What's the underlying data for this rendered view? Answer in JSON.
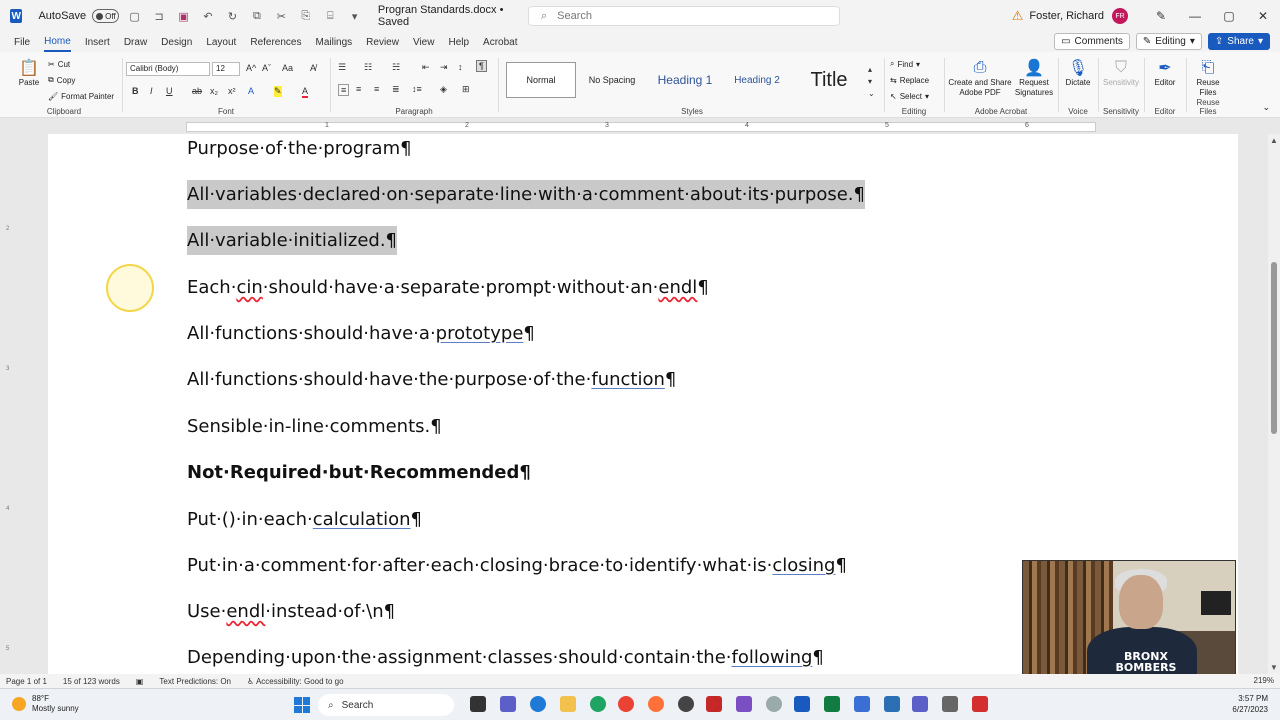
{
  "window": {
    "app_logo": "W",
    "autosave_label": "AutoSave",
    "autosave_state": "Off",
    "doc_title": "Progran Standards.docx • Saved",
    "search_placeholder": "Search",
    "user_name": "Foster, Richard",
    "user_initials": "FR"
  },
  "menu": {
    "tabs": [
      "File",
      "Home",
      "Insert",
      "Draw",
      "Design",
      "Layout",
      "References",
      "Mailings",
      "Review",
      "View",
      "Help",
      "Acrobat"
    ],
    "active_tab": "Home",
    "comments_label": "Comments",
    "editing_label": "Editing",
    "share_label": "Share"
  },
  "ribbon": {
    "clipboard": {
      "label": "Clipboard",
      "paste": "Paste",
      "cut": "Cut",
      "copy": "Copy",
      "format_painter": "Format Painter"
    },
    "font": {
      "label": "Font",
      "family": "Calibri (Body)",
      "size": "12"
    },
    "paragraph": {
      "label": "Paragraph"
    },
    "styles": {
      "label": "Styles",
      "items": [
        "Normal",
        "No Spacing",
        "Heading 1",
        "Heading 2",
        "Title"
      ]
    },
    "editing": {
      "label": "Editing",
      "find": "Find",
      "replace": "Replace",
      "select": "Select"
    },
    "acrobat": {
      "label": "Adobe Acrobat",
      "create_share": "Create and Share Adobe PDF",
      "request_sig": "Request Signatures"
    },
    "voice": {
      "label": "Voice",
      "dictate": "Dictate"
    },
    "sensitivity": {
      "label": "Sensitivity",
      "btn": "Sensitivity"
    },
    "editor": {
      "label": "Editor",
      "btn": "Editor"
    },
    "reuse": {
      "label": "Reuse Files",
      "btn": "Reuse Files"
    }
  },
  "document": {
    "paragraphs": [
      {
        "text": "Purpose·of·the·program¶"
      },
      {
        "text": "All·variables·declared·on·separate·line·with·a·comment·about·its·purpose.¶",
        "selected": true
      },
      {
        "text": "All·variable·initialized.¶",
        "selected": true
      },
      {
        "text": "Each·cin·should·have·a·separate·prompt·without·an·endl¶"
      },
      {
        "text": "All·functions·should·have·a·prototype¶"
      },
      {
        "text": "All·functions·should·have·the·purpose·of·the·function¶"
      },
      {
        "text": "Sensible·in-line·comments.¶"
      },
      {
        "text": "Not·Required·but·Recommended¶",
        "bold": true
      },
      {
        "text": "Put·()·in·each·calculation¶"
      },
      {
        "text": "Put·in·a·comment·for·after·each·closing·brace·to·identify·what·is·closing¶"
      },
      {
        "text": "Use·endl·instead·of·\\n¶"
      },
      {
        "text": "Depending·upon·the·assignment·classes·should·contain·the·following¶"
      }
    ]
  },
  "webcam": {
    "shirt_text": "BRONX BOMBERS"
  },
  "status": {
    "page": "Page 1 of 1",
    "words": "15 of 123 words",
    "text_predictions": "Text Predictions: On",
    "accessibility": "Accessibility: Good to go",
    "zoom": "219%"
  },
  "taskbar": {
    "temp": "88°F",
    "weather": "Mostly sunny",
    "search": "Search",
    "time": "3:57 PM",
    "date": "6/27/2023"
  }
}
